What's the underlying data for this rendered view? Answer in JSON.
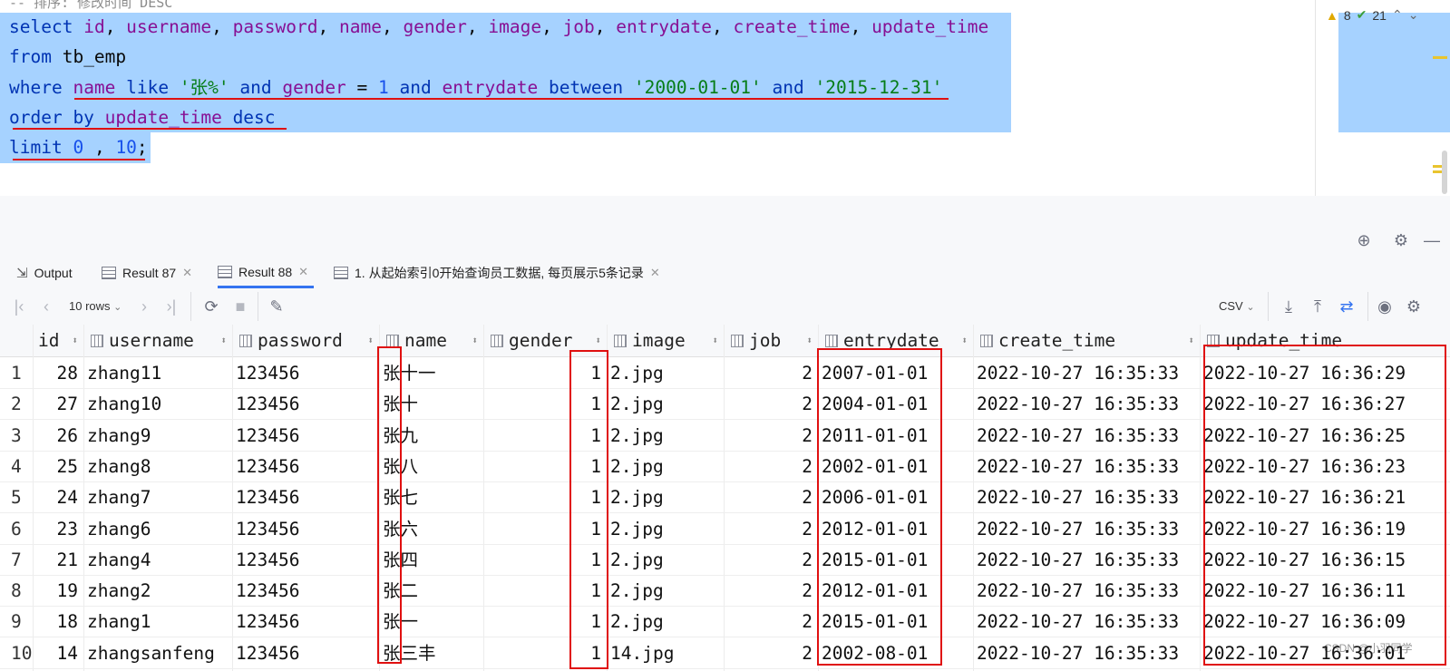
{
  "editor": {
    "partial_comment": "-- 排序: 修改时间 DESC",
    "line1": {
      "tokens": [
        {
          "t": "select",
          "c": "kw"
        },
        {
          "t": " ",
          "c": "plain"
        },
        {
          "t": "id",
          "c": "id"
        },
        {
          "t": ", ",
          "c": "plain"
        },
        {
          "t": "username",
          "c": "id"
        },
        {
          "t": ", ",
          "c": "plain"
        },
        {
          "t": "password",
          "c": "id"
        },
        {
          "t": ", ",
          "c": "plain"
        },
        {
          "t": "name",
          "c": "id"
        },
        {
          "t": ", ",
          "c": "plain"
        },
        {
          "t": "gender",
          "c": "id"
        },
        {
          "t": ", ",
          "c": "plain"
        },
        {
          "t": "image",
          "c": "id"
        },
        {
          "t": ", ",
          "c": "plain"
        },
        {
          "t": "job",
          "c": "id"
        },
        {
          "t": ", ",
          "c": "plain"
        },
        {
          "t": "entrydate",
          "c": "id"
        },
        {
          "t": ", ",
          "c": "plain"
        },
        {
          "t": "create_time",
          "c": "id"
        },
        {
          "t": ", ",
          "c": "plain"
        },
        {
          "t": "update_time",
          "c": "id"
        }
      ]
    },
    "line2": {
      "tokens": [
        {
          "t": "from",
          "c": "kw"
        },
        {
          "t": " tb_emp",
          "c": "plain"
        }
      ]
    },
    "line3": {
      "tokens": [
        {
          "t": "where",
          "c": "kw"
        },
        {
          "t": " ",
          "c": "plain"
        },
        {
          "t": "name",
          "c": "id"
        },
        {
          "t": " ",
          "c": "plain"
        },
        {
          "t": "like",
          "c": "kw"
        },
        {
          "t": " ",
          "c": "plain"
        },
        {
          "t": "'张%'",
          "c": "str"
        },
        {
          "t": " ",
          "c": "plain"
        },
        {
          "t": "and",
          "c": "kw"
        },
        {
          "t": " ",
          "c": "plain"
        },
        {
          "t": "gender",
          "c": "id"
        },
        {
          "t": " = ",
          "c": "plain"
        },
        {
          "t": "1",
          "c": "num"
        },
        {
          "t": " ",
          "c": "plain"
        },
        {
          "t": "and",
          "c": "kw"
        },
        {
          "t": " ",
          "c": "plain"
        },
        {
          "t": "entrydate",
          "c": "id"
        },
        {
          "t": " ",
          "c": "plain"
        },
        {
          "t": "between",
          "c": "kw"
        },
        {
          "t": " ",
          "c": "plain"
        },
        {
          "t": "'2000-01-01'",
          "c": "str"
        },
        {
          "t": " ",
          "c": "plain"
        },
        {
          "t": "and",
          "c": "kw"
        },
        {
          "t": " ",
          "c": "plain"
        },
        {
          "t": "'2015-12-31'",
          "c": "str"
        }
      ]
    },
    "line4": {
      "tokens": [
        {
          "t": "order by",
          "c": "kw"
        },
        {
          "t": " ",
          "c": "plain"
        },
        {
          "t": "update_time",
          "c": "id"
        },
        {
          "t": " ",
          "c": "plain"
        },
        {
          "t": "desc",
          "c": "kw"
        }
      ]
    },
    "line5": {
      "tokens": [
        {
          "t": "limit",
          "c": "kw"
        },
        {
          "t": " ",
          "c": "plain"
        },
        {
          "t": "0",
          "c": "num"
        },
        {
          "t": " , ",
          "c": "plain"
        },
        {
          "t": "10",
          "c": "num"
        },
        {
          "t": ";",
          "c": "plain"
        }
      ]
    },
    "warnings_count": "8",
    "ok_count": "21"
  },
  "tabs": [
    {
      "label": "Output",
      "icon": "output-icon"
    },
    {
      "label": "Result 87",
      "icon": "table-icon"
    },
    {
      "label": "Result 88",
      "icon": "table-icon",
      "active": true
    },
    {
      "label": "1. 从起始索引0开始查询员工数据, 每页展示5条记录",
      "icon": "table-icon"
    }
  ],
  "toolbar": {
    "rows_label": "10 rows",
    "export_format": "CSV"
  },
  "grid": {
    "columns": [
      "id",
      "username",
      "password",
      "name",
      "gender",
      "image",
      "job",
      "entrydate",
      "create_time",
      "update_time"
    ],
    "rows": [
      [
        "1",
        "28",
        "zhang11",
        "123456",
        "张十一",
        "1",
        "2.jpg",
        "2",
        "2007-01-01",
        "2022-10-27 16:35:33",
        "2022-10-27 16:36:29"
      ],
      [
        "2",
        "27",
        "zhang10",
        "123456",
        "张十",
        "1",
        "2.jpg",
        "2",
        "2004-01-01",
        "2022-10-27 16:35:33",
        "2022-10-27 16:36:27"
      ],
      [
        "3",
        "26",
        "zhang9",
        "123456",
        "张九",
        "1",
        "2.jpg",
        "2",
        "2011-01-01",
        "2022-10-27 16:35:33",
        "2022-10-27 16:36:25"
      ],
      [
        "4",
        "25",
        "zhang8",
        "123456",
        "张八",
        "1",
        "2.jpg",
        "2",
        "2002-01-01",
        "2022-10-27 16:35:33",
        "2022-10-27 16:36:23"
      ],
      [
        "5",
        "24",
        "zhang7",
        "123456",
        "张七",
        "1",
        "2.jpg",
        "2",
        "2006-01-01",
        "2022-10-27 16:35:33",
        "2022-10-27 16:36:21"
      ],
      [
        "6",
        "23",
        "zhang6",
        "123456",
        "张六",
        "1",
        "2.jpg",
        "2",
        "2012-01-01",
        "2022-10-27 16:35:33",
        "2022-10-27 16:36:19"
      ],
      [
        "7",
        "21",
        "zhang4",
        "123456",
        "张四",
        "1",
        "2.jpg",
        "2",
        "2015-01-01",
        "2022-10-27 16:35:33",
        "2022-10-27 16:36:15"
      ],
      [
        "8",
        "19",
        "zhang2",
        "123456",
        "张二",
        "1",
        "2.jpg",
        "2",
        "2012-01-01",
        "2022-10-27 16:35:33",
        "2022-10-27 16:36:11"
      ],
      [
        "9",
        "18",
        "zhang1",
        "123456",
        "张一",
        "1",
        "2.jpg",
        "2",
        "2015-01-01",
        "2022-10-27 16:35:33",
        "2022-10-27 16:36:09"
      ],
      [
        "10",
        "14",
        "zhangsanfeng",
        "123456",
        "张三丰",
        "1",
        "14.jpg",
        "2",
        "2002-08-01",
        "2022-10-27 16:35:33",
        "2022-10-27 16:36:01"
      ]
    ]
  },
  "watermark": "CSDN @小羽同学",
  "colors": {
    "selection": "#a6d2ff",
    "highlight": "#e01010",
    "accent": "#3574f0"
  }
}
